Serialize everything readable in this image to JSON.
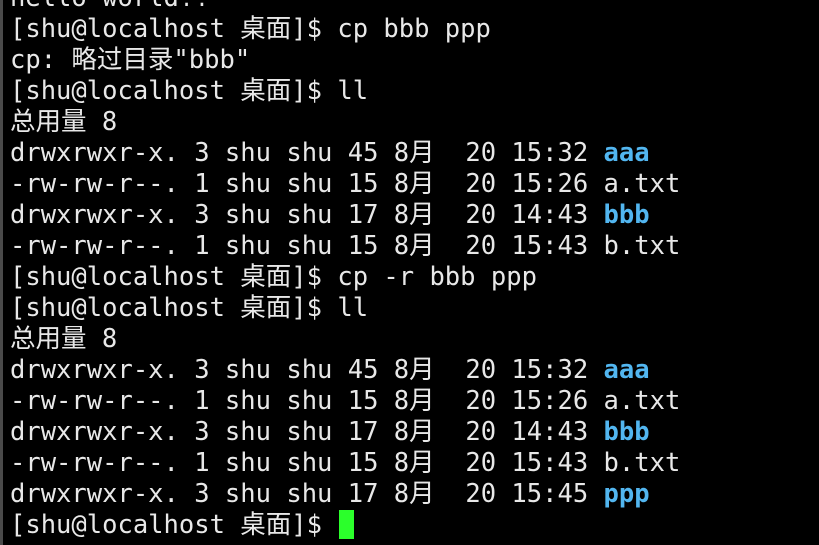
{
  "terminal": {
    "colors": {
      "background": "#000000",
      "foreground": "#e8e8e8",
      "directory": "#52b6f0",
      "cursor": "#2bff2b"
    },
    "lines": [
      {
        "text": "hello world!!"
      },
      {
        "text": "[shu@localhost 桌面]$ cp bbb ppp"
      },
      {
        "text": "cp: 略过目录\"bbb\""
      },
      {
        "text": "[shu@localhost 桌面]$ ll"
      },
      {
        "text": "总用量 8"
      },
      {
        "text": "drwxrwxr-x. 3 shu shu 45 8月  20 15:32 ",
        "name": "aaa",
        "is_dir": true
      },
      {
        "text": "-rw-rw-r--. 1 shu shu 15 8月  20 15:26 ",
        "name": "a.txt",
        "is_dir": false
      },
      {
        "text": "drwxrwxr-x. 3 shu shu 17 8月  20 14:43 ",
        "name": "bbb",
        "is_dir": true
      },
      {
        "text": "-rw-rw-r--. 1 shu shu 15 8月  20 15:43 ",
        "name": "b.txt",
        "is_dir": false
      },
      {
        "text": "[shu@localhost 桌面]$ cp -r bbb ppp"
      },
      {
        "text": "[shu@localhost 桌面]$ ll"
      },
      {
        "text": "总用量 8"
      },
      {
        "text": "drwxrwxr-x. 3 shu shu 45 8月  20 15:32 ",
        "name": "aaa",
        "is_dir": true
      },
      {
        "text": "-rw-rw-r--. 1 shu shu 15 8月  20 15:26 ",
        "name": "a.txt",
        "is_dir": false
      },
      {
        "text": "drwxrwxr-x. 3 shu shu 17 8月  20 14:43 ",
        "name": "bbb",
        "is_dir": true
      },
      {
        "text": "-rw-rw-r--. 1 shu shu 15 8月  20 15:43 ",
        "name": "b.txt",
        "is_dir": false
      },
      {
        "text": "drwxrwxr-x. 3 shu shu 17 8月  20 15:45 ",
        "name": "ppp",
        "is_dir": true
      },
      {
        "text": "[shu@localhost 桌面]$ ",
        "cursor": true
      }
    ]
  }
}
